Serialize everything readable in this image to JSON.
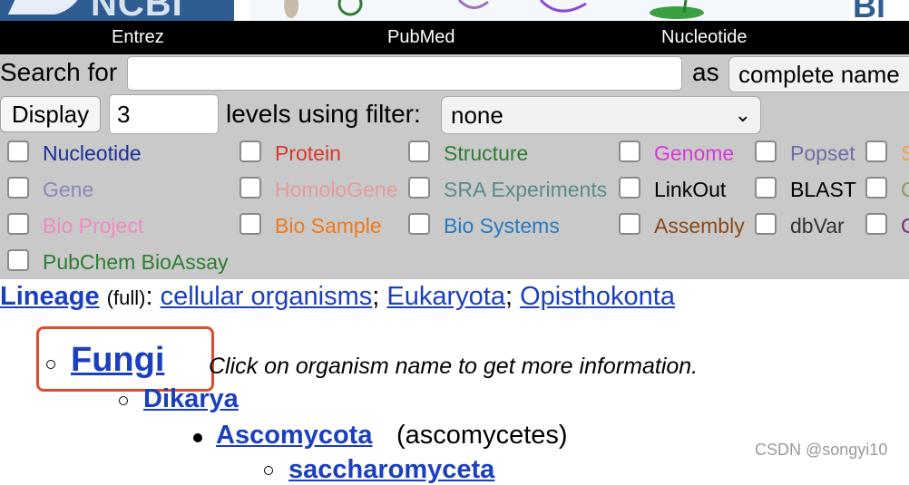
{
  "banner": {
    "logo_text": "NCBI",
    "right_text": "Bi"
  },
  "nav": {
    "items": [
      "Entrez",
      "PubMed",
      "Nucleotide"
    ]
  },
  "search": {
    "label": "Search for",
    "value": "",
    "as_label": "as",
    "mode_value": "complete name"
  },
  "display": {
    "button_label": "Display",
    "levels_value": "3",
    "levels_label": "levels using filter:",
    "filter_value": "none"
  },
  "checkboxes": [
    {
      "label": "Nucleotide",
      "color": "#1a2f9a"
    },
    {
      "label": "Protein",
      "color": "#d93a2b"
    },
    {
      "label": "Structure",
      "color": "#2e7d32"
    },
    {
      "label": "Genome",
      "color": "#d63ad6"
    },
    {
      "label": "Popset",
      "color": "#6e6ea8"
    },
    {
      "label": "S",
      "color": "#f0a050"
    },
    {
      "label": "Gene",
      "color": "#8a8ab8"
    },
    {
      "label": "HomoloGene",
      "color": "#e89a9a"
    },
    {
      "label": "SRA Experiments",
      "color": "#5a8a8a"
    },
    {
      "label": "LinkOut",
      "color": "#000000"
    },
    {
      "label": "BLAST",
      "color": "#000000"
    },
    {
      "label": "G",
      "color": "#8a9a5a"
    },
    {
      "label": "Bio Project",
      "color": "#f08ac0"
    },
    {
      "label": "Bio Sample",
      "color": "#f07a1a"
    },
    {
      "label": "Bio Systems",
      "color": "#2a7ac0"
    },
    {
      "label": "Assembly",
      "color": "#8a4a1a"
    },
    {
      "label": "dbVar",
      "color": "#333333"
    },
    {
      "label": "C",
      "color": "#7a2a7a"
    },
    {
      "label": "PubChem BioAssay",
      "color": "#2e7d32"
    }
  ],
  "lineage": {
    "label": "Lineage",
    "qualifier": "(full)",
    "colon": ":",
    "items": [
      "cellular organisms",
      "Eukaryota",
      "Opisthokonta"
    ],
    "separator": ";"
  },
  "tree": {
    "current": "Fungi",
    "note": "Click on organism name to get more information.",
    "child1": "Dikarya",
    "child2": "Ascomycota",
    "child2_common": "(ascomycetes)",
    "child3": "saccharomyceta"
  },
  "watermark": "CSDN @songyi10",
  "colors": {
    "nav_bg": "#000000",
    "panel_bg": "#c9c9c9",
    "link": "#1a3fbf",
    "highlight": "#e24a32"
  }
}
